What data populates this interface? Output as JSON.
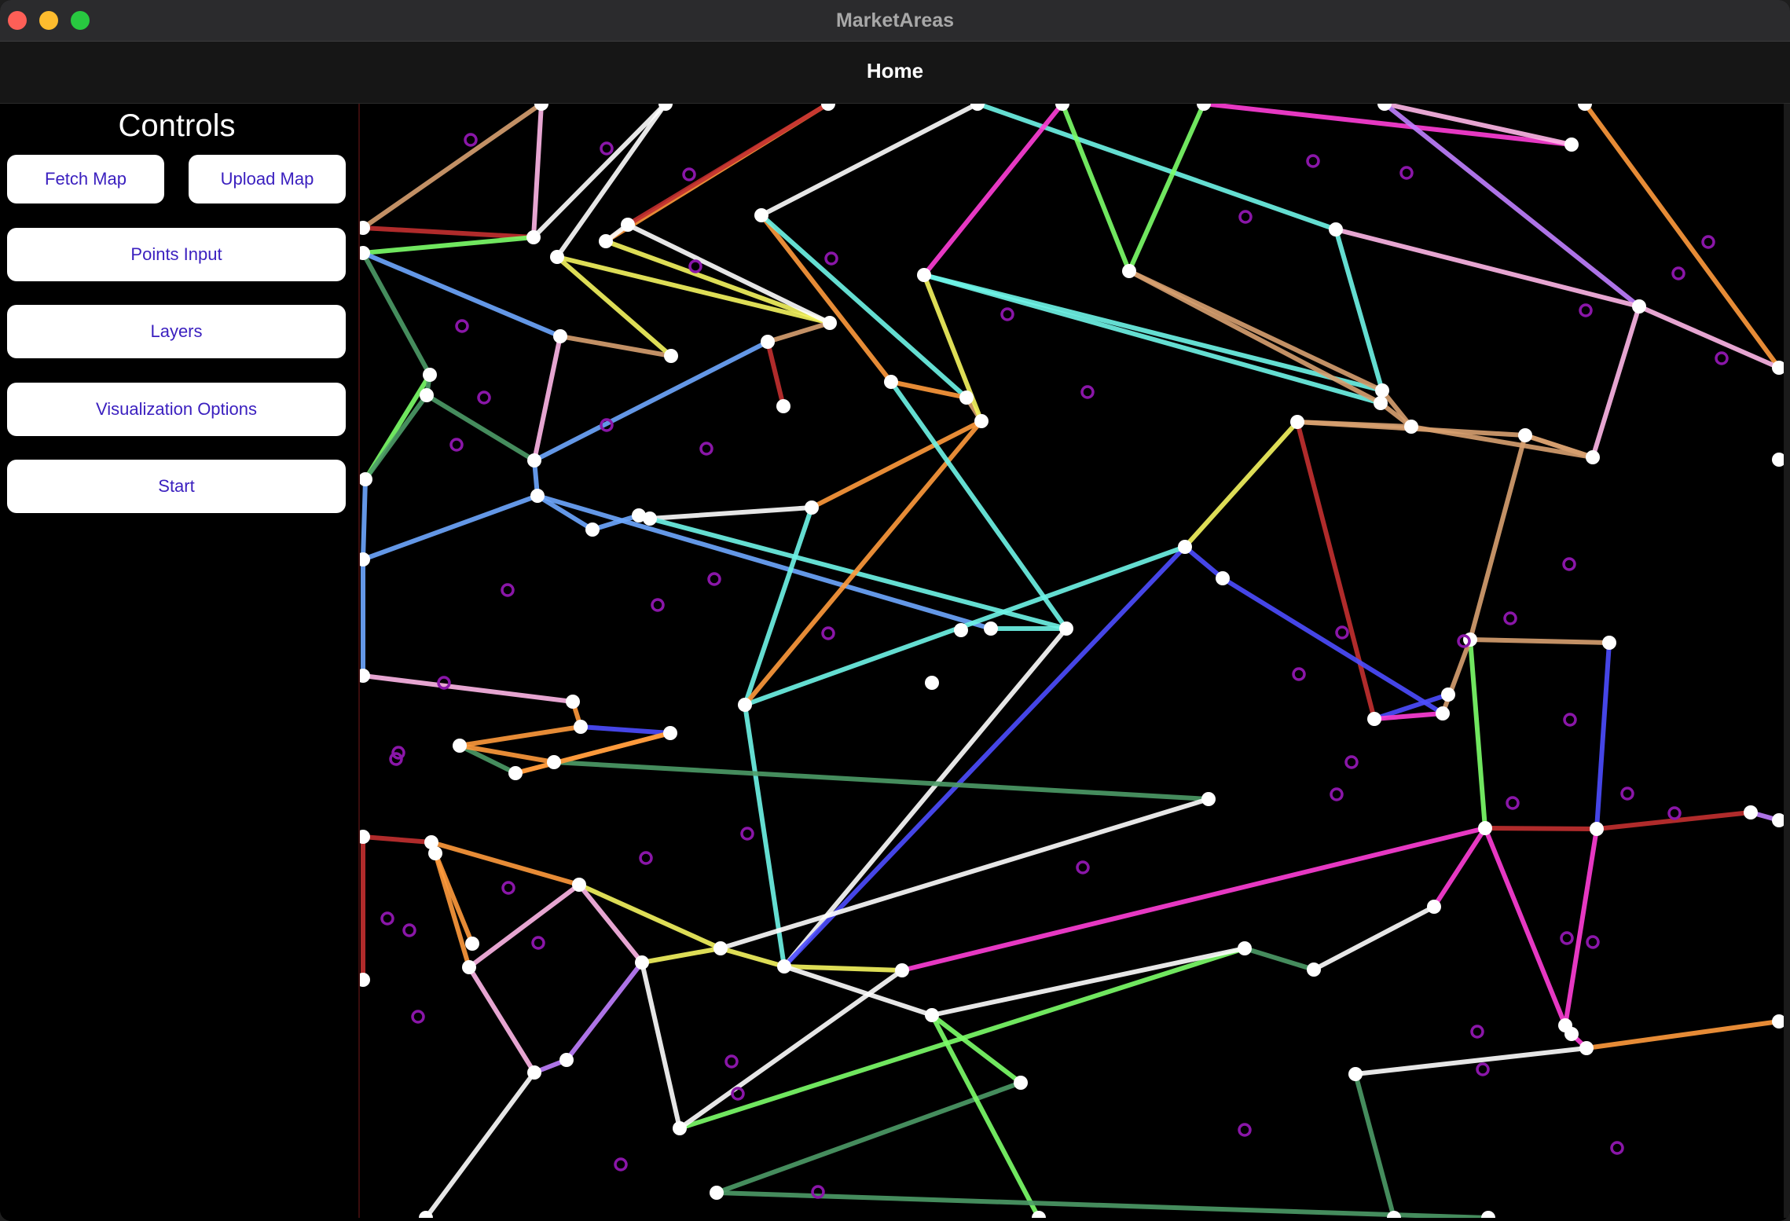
{
  "window": {
    "title": "MarketAreas"
  },
  "navbar": {
    "title": "Home"
  },
  "sidebar": {
    "title": "Controls",
    "buttons": {
      "fetch_map": "Fetch Map",
      "upload_map": "Upload Map",
      "points_input": "Points Input",
      "layers": "Layers",
      "visualization_options": "Visualization Options",
      "start": "Start"
    }
  },
  "map": {
    "background_color": "#000000",
    "vertex_color": "#ffffff",
    "site_color": "#8a16a8",
    "edge_colors": [
      "#6ea8ff",
      "#f5f560",
      "#6ff5e8",
      "#ff3fd8",
      "#7dff6a",
      "#ff9b3c",
      "#c43030",
      "#4d4dff",
      "#c080ff",
      "#ffb7e8",
      "#d8a070",
      "#4d9c68",
      "#ffffff"
    ]
  }
}
